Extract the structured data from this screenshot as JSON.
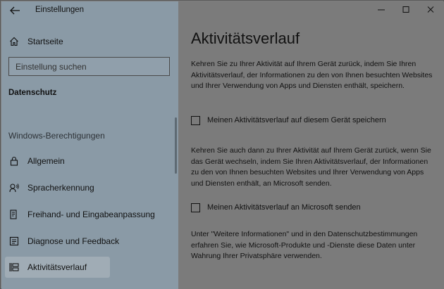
{
  "window": {
    "title": "Einstellungen"
  },
  "sidebar": {
    "home_label": "Startseite",
    "search_placeholder": "Einstellung suchen",
    "section_title": "Datenschutz",
    "group_title": "Windows-Berechtigungen",
    "items": [
      {
        "label": "Allgemein",
        "icon": "lock-icon"
      },
      {
        "label": "Spracherkennung",
        "icon": "speech-icon"
      },
      {
        "label": "Freihand- und Eingabeanpassung",
        "icon": "document-pen-icon"
      },
      {
        "label": "Diagnose und Feedback",
        "icon": "feedback-icon"
      },
      {
        "label": "Aktivitätsverlauf",
        "icon": "timeline-icon",
        "selected": true
      }
    ]
  },
  "main": {
    "title": "Aktivitätsverlauf",
    "intro": "Kehren Sie zu Ihrer Aktivität auf Ihrem Gerät zurück, indem Sie Ihren Aktivitätsverlauf, der Informationen zu den von Ihnen besuchten Websites und Ihrer Verwendung von Apps und Diensten enthält, speichern.",
    "checkbox1_label": "Meinen Aktivitätsverlauf auf diesem Gerät speichern",
    "checkbox1_checked": false,
    "para2": "Kehren Sie auch dann zu Ihrer Aktivität auf Ihrem Gerät zurück, wenn Sie das Gerät wechseln, indem Sie Ihren Aktivitätsverlauf, der Informationen zu den von Ihnen besuchten Websites und Ihrer Verwendung von Apps und Diensten enthält, an Microsoft senden.",
    "checkbox2_label": "Meinen Aktivitätsverlauf an Microsoft senden",
    "checkbox2_checked": false,
    "para3": "Unter \"Weitere Informationen\" und in den Datenschutzbestimmungen erfahren Sie, wie Microsoft-Produkte und -Dienste diese Daten unter Wahrung Ihrer Privatsphäre verwenden."
  },
  "colors": {
    "sidebar_bg": "#8a9aa6",
    "content_bg": "#7b7b7b",
    "selected_bg": "#a0acb5"
  }
}
